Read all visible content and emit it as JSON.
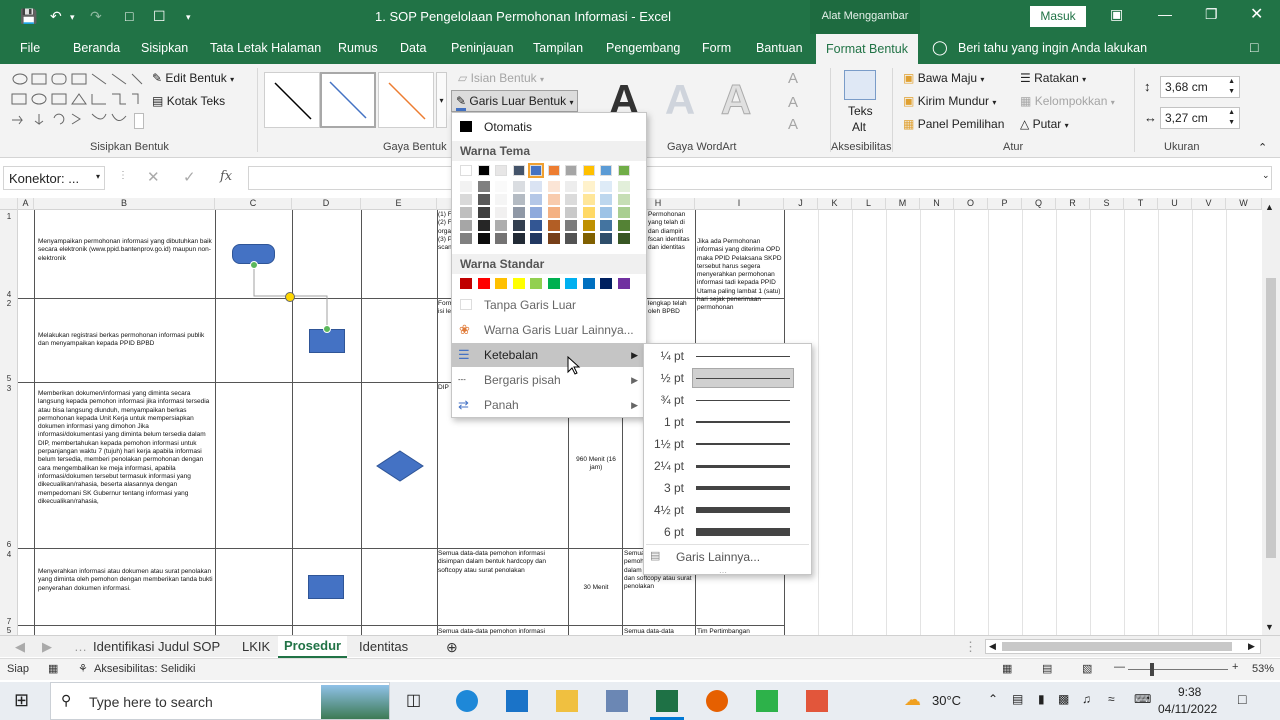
{
  "titlebar": {
    "doc_title": "1. SOP Pengelolaan Permohonan Informasi  -  Excel",
    "context_title": "Alat Menggambar",
    "signin": "Masuk"
  },
  "menu_tabs": [
    "File",
    "Beranda",
    "Sisipkan",
    "Tata Letak Halaman",
    "Rumus",
    "Data",
    "Peninjauan",
    "Tampilan",
    "Pengembang",
    "Form",
    "Bantuan",
    "Format Bentuk"
  ],
  "tell_me": "Beri tahu yang ingin Anda lakukan",
  "ribbon": {
    "edit_shape": "Edit Bentuk",
    "text_box": "Kotak Teks",
    "group_insert_shapes": "Sisipkan Bentuk",
    "shape_fill": "Isian Bentuk",
    "shape_outline": "Garis Luar Bentuk",
    "group_shape_styles": "Gaya Bentuk",
    "group_wordart": "Gaya WordArt",
    "alt_text_1": "Teks",
    "alt_text_2": "Alt",
    "group_accessibility": "Aksesibilitas",
    "bring_forward": "Bawa Maju",
    "send_backward": "Kirim Mundur",
    "selection_pane": "Panel Pemilihan",
    "align": "Ratakan",
    "group": "Kelompokkan",
    "rotate": "Putar",
    "group_arrange": "Atur",
    "height": "3,68 cm",
    "width": "3,27 cm",
    "group_size": "Ukuran"
  },
  "formula": {
    "name_box": "Konektor: ...",
    "fx": "fx"
  },
  "columns": [
    "A",
    "B",
    "C",
    "D",
    "E",
    "F",
    "G",
    "H",
    "I",
    "J",
    "K",
    "L",
    "M",
    "N",
    "O",
    "P",
    "Q",
    "R",
    "S",
    "T",
    "U",
    "V",
    "W"
  ],
  "rows": {
    "r1": {
      "num": "1",
      "side": "4",
      "text": "Menyampaikan permohonan informasi yang dibutuhkan baik secara elektronik (www.ppid.bantenprov.go.id) maupun non-elektronik"
    },
    "r2": {
      "num": "2",
      "side": "5",
      "text": "Melakukan registrasi berkas permohonan informasi publik dan menyampaikan kepada PPID BPBD"
    },
    "r3": {
      "num": "3",
      "side": "6",
      "text": "Memberikan dokumen/informasi yang diminta secara langsung kepada pemohon informasi jika informasi tersedia atau bisa langsung diunduh, menyampaikan berkas permohonan kepada Unit Kerja untuk mempersiapkan dokumen informasi yang dimohon Jika informasi/dokumentasi yang diminta belum tersedia dalam DIP, membertahukan kepada pemohon informasi untuk perpanjangan waktu 7 (tujuh) hari kerja apabila informasi belum tersedia, memberi penolakan permohonan dengan cara mengembalikan ke meja informasi, apabila informasi/dokumen tersebut termasuk informasi yang dikecualikan/rahasia, beserta alasannya dengan mempedomani SK Gubernur tentang informasi yang dikecualikan/rahasia,"
    },
    "r4": {
      "num": "4",
      "side": "7",
      "text": "Menyerahkan informasi atau dokumen atau surat penolakan yang diminta oleh pemohon dengan memberikan tanda bukti penyerahan dokumen informasi."
    },
    "r5": {
      "num": "5"
    },
    "f1": "(1) F (2) F orga (3) P scan",
    "f2": "Form isi le",
    "f3": "DIP",
    "f4": "Semua data-data pemohon informasi disimpan dalam bentuk hardcopy dan softcopy atau surat penolakan",
    "f5": "Semua data-data pemohon informasi disimpan",
    "g3": "960 Menit (16 jam)",
    "g4": "30 Menit",
    "h1": "Permohonan yang telah di dan diampiri fscan identitas dan identitas",
    "h2": "lengkap telah oleh BPBD",
    "h4": "Semua data-data pemohon disimpan dalam bentuk hardcopy dan softcopy atau surat penolakan",
    "h5": "Semua data-data",
    "i1": "Jika ada Permohonan informasi yang diterima OPD maka PPID Pelaksana SKPD tersebut harus segera menyerahkan permohonan informasi tadi kepada PPID Utama paling lambat 1 (satu) hari sejak penerimaan permohonan",
    "i5": "Tim Pertimbangan"
  },
  "outline_menu": {
    "automatic": "Otomatis",
    "theme_colors": "Warna Tema",
    "standard_colors": "Warna Standar",
    "no_outline": "Tanpa Garis Luar",
    "more_colors": "Warna Garis Luar Lainnya...",
    "weight": "Ketebalan",
    "dashes": "Bergaris pisah",
    "arrows": "Panah",
    "theme_top": [
      "#ffffff",
      "#000000",
      "#e7e6e6",
      "#44546a",
      "#4472c4",
      "#ed7d31",
      "#a5a5a5",
      "#ffc000",
      "#5b9bd5",
      "#70ad47"
    ],
    "standard": [
      "#c00000",
      "#ff0000",
      "#ffc000",
      "#ffff00",
      "#92d050",
      "#00b050",
      "#00b0f0",
      "#0070c0",
      "#002060",
      "#7030a0"
    ]
  },
  "weight_menu": {
    "items": [
      "¼ pt",
      "½ pt",
      "¾ pt",
      "1 pt",
      "1½ pt",
      "2¼ pt",
      "3 pt",
      "4½ pt",
      "6 pt"
    ],
    "selected": "½ pt",
    "more_lines": "Garis Lainnya..."
  },
  "sheet_tabs": [
    "Identifikasi Judul SOP",
    "LKIK",
    "Prosedur",
    "Identitas"
  ],
  "active_sheet": "Prosedur",
  "status": {
    "ready": "Siap",
    "accessibility": "Aksesibilitas: Selidiki",
    "zoom": "53%"
  },
  "taskbar": {
    "search_placeholder": "Type here to search",
    "temperature": "30°C",
    "time": "9:38",
    "date": "04/11/2022"
  }
}
